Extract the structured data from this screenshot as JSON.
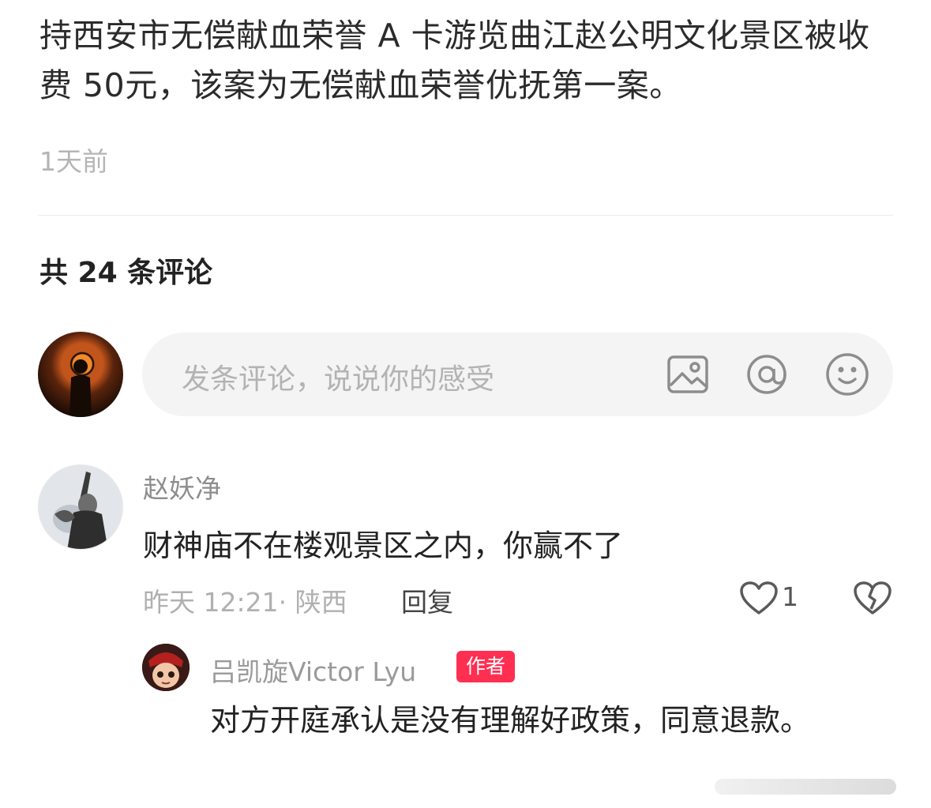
{
  "post": {
    "text": "持西安市无偿献血荣誉 A 卡游览曲江赵公明文化景区被收费 50元，该案为无偿献血荣誉优抚第一案。",
    "time": "1天前"
  },
  "comments_header": {
    "count_text": "共 24 条评论"
  },
  "comment_input": {
    "placeholder": "发条评论，说说你的感受",
    "icons": [
      "image-icon",
      "at-icon",
      "emoji-icon"
    ]
  },
  "comments": [
    {
      "author": "赵妖净",
      "text": "财神庙不在楼观景区之内，你赢不了",
      "meta": "昨天 12:21· 陕西",
      "reply_label": "回复",
      "likes": "1",
      "replies": [
        {
          "author": "吕凯旋Victor Lyu",
          "badge": "作者",
          "text": "对方开庭承认是没有理解好政策，同意退款。"
        }
      ]
    }
  ],
  "colors": {
    "badge": "#ff2f52",
    "placeholder": "#b3b3b3",
    "meta": "#b0b0b0"
  }
}
